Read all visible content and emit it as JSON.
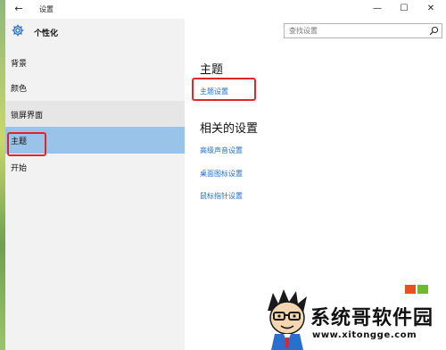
{
  "titlebar": {
    "back_glyph": "←",
    "title": "设置",
    "minimize_glyph": "—",
    "maximize_glyph": "☐",
    "close_glyph": "✕"
  },
  "sidebar": {
    "header": "个性化",
    "items": [
      {
        "label": "背景",
        "state": "normal"
      },
      {
        "label": "颜色",
        "state": "normal"
      },
      {
        "label": "锁屏界面",
        "state": "hover"
      },
      {
        "label": "主题",
        "state": "selected"
      },
      {
        "label": "开始",
        "state": "normal"
      }
    ]
  },
  "search": {
    "placeholder": "查找设置",
    "icon": "search-icon"
  },
  "main": {
    "theme_title": "主题",
    "theme_settings_link": "主题设置",
    "related_title": "相关的设置",
    "related_links": [
      "高级声音设置",
      "桌面图标设置",
      "鼠标指针设置"
    ]
  },
  "watermark": {
    "name": "系统哥软件园",
    "url": "www.xitongge.com"
  },
  "colors": {
    "accent": "#1f6fc4",
    "selected": "#99c3e8",
    "sidebar_bg": "#f2f2f2",
    "highlight_box": "#e0252b"
  }
}
